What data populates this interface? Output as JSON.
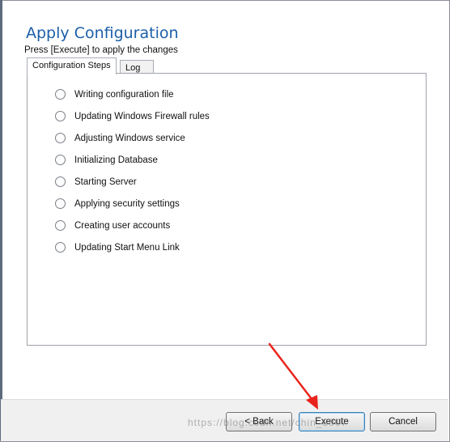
{
  "window": {
    "title": "Apply Configuration",
    "instruction": "Press [Execute] to apply the changes"
  },
  "tabs": [
    {
      "label": "Configuration Steps",
      "selected": true
    },
    {
      "label": "Log",
      "selected": false
    }
  ],
  "steps": [
    {
      "label": "Writing configuration file"
    },
    {
      "label": "Updating Windows Firewall rules"
    },
    {
      "label": "Adjusting Windows service"
    },
    {
      "label": "Initializing Database"
    },
    {
      "label": "Starting Server"
    },
    {
      "label": "Applying security settings"
    },
    {
      "label": "Creating user accounts"
    },
    {
      "label": "Updating Start Menu Link"
    }
  ],
  "buttons": {
    "back": "< Back",
    "execute": "Execute",
    "cancel": "Cancel"
  },
  "watermark": "https://blog.csdn.net/chin_8007",
  "annotation": {
    "color": "#e8231b"
  }
}
